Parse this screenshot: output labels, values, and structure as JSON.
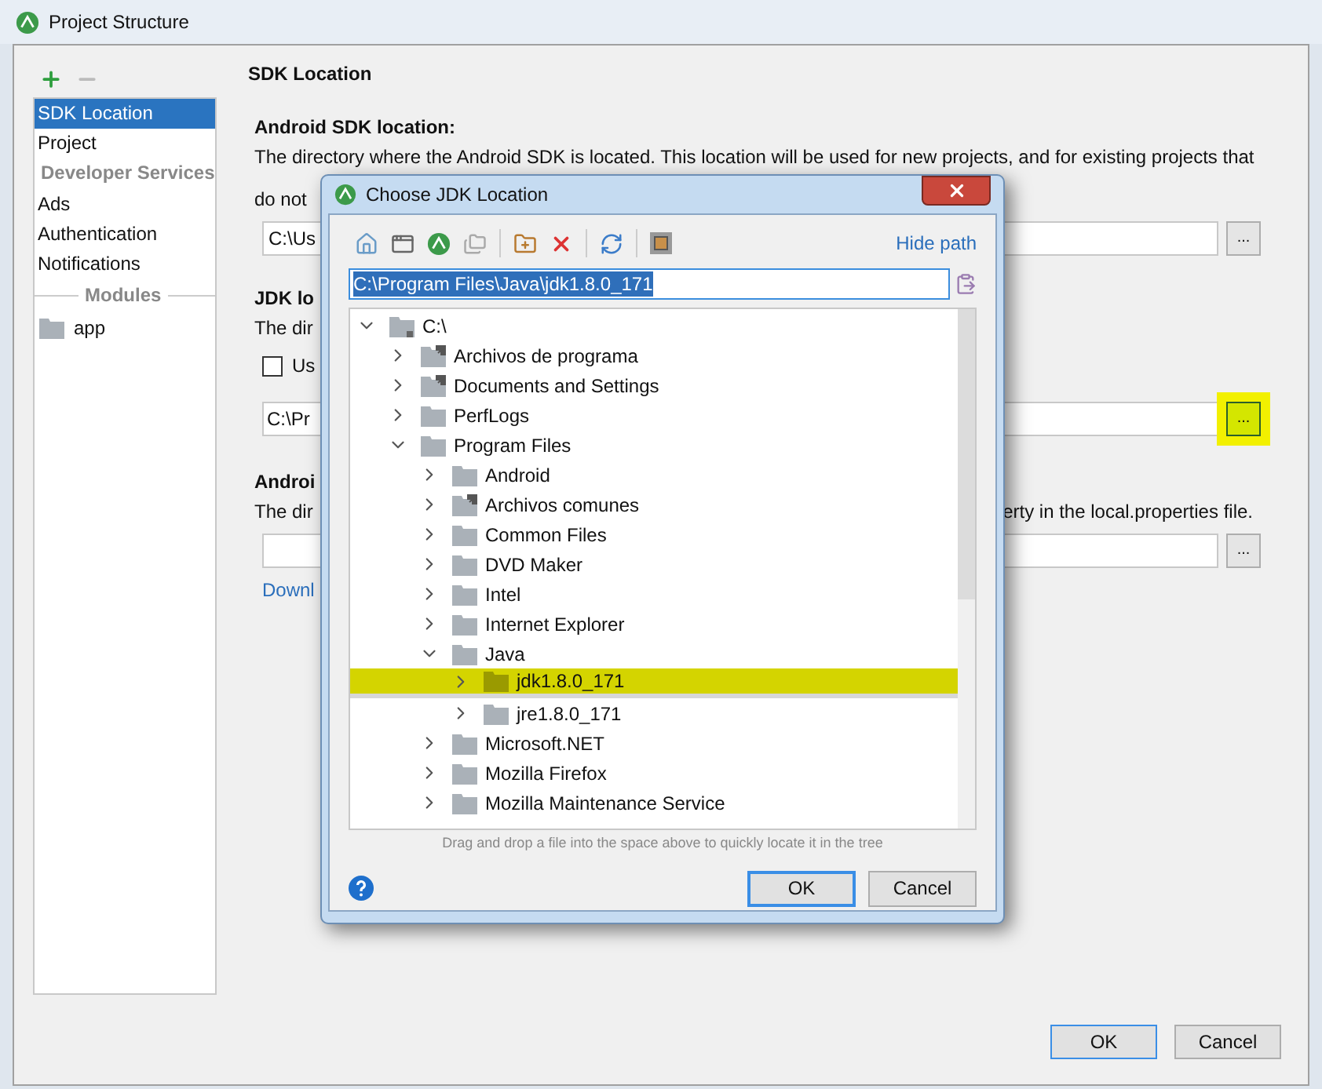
{
  "window": {
    "title": "Project Structure"
  },
  "sidebar": {
    "items": [
      {
        "label": "SDK Location",
        "kind": "item",
        "selected": true
      },
      {
        "label": "Project",
        "kind": "item",
        "selected": false
      },
      {
        "label": "Developer Services",
        "kind": "header",
        "selected": false
      },
      {
        "label": "Ads",
        "kind": "item",
        "selected": false
      },
      {
        "label": "Authentication",
        "kind": "item",
        "selected": false
      },
      {
        "label": "Notifications",
        "kind": "item",
        "selected": false
      },
      {
        "label": "Modules",
        "kind": "divider",
        "selected": false
      },
      {
        "label": "app",
        "kind": "module",
        "selected": false
      }
    ]
  },
  "content": {
    "heading": "SDK Location",
    "android_sdk": {
      "title": "Android SDK location:",
      "description_line_1": "The directory where the Android SDK is located. This location will be used for new projects, and for existing projects that",
      "description_line_2": "do not",
      "value": "C:\\Us",
      "browse": "..."
    },
    "jdk": {
      "title": "JDK lo",
      "description": "The dir",
      "checkbox": {
        "label": "Us",
        "checked": false
      },
      "value": "C:\\Pr",
      "browse": "...",
      "highlighted": true
    },
    "android_ndk": {
      "title": "Androi",
      "description": "The dir",
      "description_end": "erty in the local.properties file.",
      "browse": "...",
      "link": "Downl"
    }
  },
  "buttons": [
    "OK",
    "Cancel"
  ],
  "dialog": {
    "title": "Choose JDK Location",
    "hide_path": "Hide path",
    "path": "C:\\Program Files\\Java\\jdk1.8.0_171",
    "tree": [
      {
        "label": "C:\\",
        "kind": "drive",
        "shortcut": false,
        "expanded": true,
        "selected": false,
        "children": [
          {
            "label": "Archivos de programa",
            "kind": "folder",
            "shortcut": true,
            "expanded": false,
            "selected": false
          },
          {
            "label": "Documents and Settings",
            "kind": "folder",
            "shortcut": true,
            "expanded": false,
            "selected": false
          },
          {
            "label": "PerfLogs",
            "kind": "folder",
            "shortcut": false,
            "expanded": false,
            "selected": false
          },
          {
            "label": "Program Files",
            "kind": "folder",
            "shortcut": false,
            "expanded": true,
            "selected": false,
            "children": [
              {
                "label": "Android",
                "kind": "folder",
                "shortcut": false,
                "expanded": false,
                "selected": false
              },
              {
                "label": "Archivos comunes",
                "kind": "folder",
                "shortcut": true,
                "expanded": false,
                "selected": false
              },
              {
                "label": "Common Files",
                "kind": "folder",
                "shortcut": false,
                "expanded": false,
                "selected": false
              },
              {
                "label": "DVD Maker",
                "kind": "folder",
                "shortcut": false,
                "expanded": false,
                "selected": false
              },
              {
                "label": "Intel",
                "kind": "folder",
                "shortcut": false,
                "expanded": false,
                "selected": false
              },
              {
                "label": "Internet Explorer",
                "kind": "folder",
                "shortcut": false,
                "expanded": false,
                "selected": false
              },
              {
                "label": "Java",
                "kind": "folder",
                "shortcut": false,
                "expanded": true,
                "selected": false,
                "children": [
                  {
                    "label": "jdk1.8.0_171",
                    "kind": "folder",
                    "shortcut": false,
                    "expanded": false,
                    "selected": true
                  },
                  {
                    "label": "jre1.8.0_171",
                    "kind": "folder",
                    "shortcut": false,
                    "expanded": false,
                    "selected": false
                  }
                ]
              },
              {
                "label": "Microsoft.NET",
                "kind": "folder",
                "shortcut": false,
                "expanded": false,
                "selected": false
              },
              {
                "label": "Mozilla Firefox",
                "kind": "folder",
                "shortcut": false,
                "expanded": false,
                "selected": false
              },
              {
                "label": "Mozilla Maintenance Service",
                "kind": "folder",
                "shortcut": false,
                "expanded": false,
                "selected": false
              }
            ]
          }
        ]
      }
    ],
    "hint": "Drag and drop a file into the space above to quickly locate it in the tree",
    "buttons": [
      "OK",
      "Cancel"
    ]
  }
}
